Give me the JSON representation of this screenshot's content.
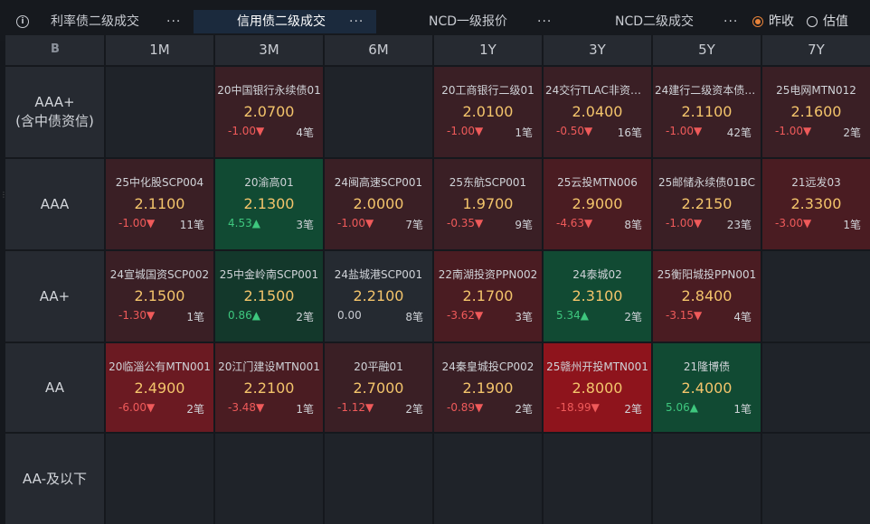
{
  "tabs": [
    {
      "label": "利率债二级成交",
      "more": "···",
      "active": false
    },
    {
      "label": "信用债二级成交",
      "more": "···",
      "active": true
    },
    {
      "label": "NCD一级报价",
      "more": "···",
      "active": false
    },
    {
      "label": "NCD二级成交",
      "more": "···",
      "active": false
    }
  ],
  "info_icon": "i",
  "options": {
    "prev_close": "昨收",
    "valuation": "估值",
    "selected": "prev_close"
  },
  "corner_symbol": "B",
  "columns": [
    "1M",
    "3M",
    "6M",
    "1Y",
    "3Y",
    "5Y",
    "7Y"
  ],
  "rows": [
    {
      "label": [
        "AAA+",
        "(含中债资信)"
      ],
      "cells": [
        null,
        {
          "name": "20中国银行永续债01",
          "price": "2.0700",
          "change": "-1.00▼",
          "count": "4笔",
          "tone": "c-dr",
          "dir": "neg"
        },
        null,
        {
          "name": "20工商银行二级01",
          "price": "2.0100",
          "change": "-1.00▼",
          "count": "1笔",
          "tone": "c-dr",
          "dir": "neg"
        },
        {
          "name": "24交行TLAC非资本...",
          "price": "2.0400",
          "change": "-0.50▼",
          "count": "16笔",
          "tone": "c-dr",
          "dir": "neg"
        },
        {
          "name": "24建行二级资本债0...",
          "price": "2.1100",
          "change": "-1.00▼",
          "count": "42笔",
          "tone": "c-dr",
          "dir": "neg"
        },
        {
          "name": "25电网MTN012",
          "price": "2.1600",
          "change": "-1.00▼",
          "count": "2笔",
          "tone": "c-dr",
          "dir": "neg"
        }
      ]
    },
    {
      "label": [
        "AAA"
      ],
      "cells": [
        {
          "name": "25中化股SCP004",
          "price": "2.1100",
          "change": "-1.00▼",
          "count": "11笔",
          "tone": "c-dr",
          "dir": "neg"
        },
        {
          "name": "20渝高01",
          "price": "2.1300",
          "change": "4.53▲",
          "count": "3笔",
          "tone": "c-g",
          "dir": "pos"
        },
        {
          "name": "24闽高速SCP001",
          "price": "2.0000",
          "change": "-1.00▼",
          "count": "7笔",
          "tone": "c-dr",
          "dir": "neg"
        },
        {
          "name": "25东航SCP001",
          "price": "1.9700",
          "change": "-0.35▼",
          "count": "9笔",
          "tone": "c-dr",
          "dir": "neg"
        },
        {
          "name": "25云投MTN006",
          "price": "2.9000",
          "change": "-4.63▼",
          "count": "8笔",
          "tone": "c-r",
          "dir": "neg"
        },
        {
          "name": "25邮储永续债01BC",
          "price": "2.2150",
          "change": "-1.00▼",
          "count": "23笔",
          "tone": "c-dr",
          "dir": "neg"
        },
        {
          "name": "21远发03",
          "price": "2.3300",
          "change": "-3.00▼",
          "count": "1笔",
          "tone": "c-r",
          "dir": "neg"
        }
      ]
    },
    {
      "label": [
        "AA+"
      ],
      "cells": [
        {
          "name": "24宣城国资SCP002",
          "price": "2.1500",
          "change": "-1.30▼",
          "count": "1笔",
          "tone": "c-dr",
          "dir": "neg"
        },
        {
          "name": "25中金岭南SCP001",
          "price": "2.1500",
          "change": "0.86▲",
          "count": "2笔",
          "tone": "c-dg",
          "dir": "pos"
        },
        {
          "name": "24盐城港SCP001",
          "price": "2.2100",
          "change": "0.00",
          "count": "8笔",
          "tone": "c-n",
          "dir": "flat"
        },
        {
          "name": "22南湖投资PPN002",
          "price": "2.1700",
          "change": "-3.62▼",
          "count": "3笔",
          "tone": "c-r",
          "dir": "neg"
        },
        {
          "name": "24泰城02",
          "price": "2.3100",
          "change": "5.34▲",
          "count": "2笔",
          "tone": "c-g",
          "dir": "pos"
        },
        {
          "name": "25衡阳城投PPN001",
          "price": "2.8400",
          "change": "-3.15▼",
          "count": "4笔",
          "tone": "c-r",
          "dir": "neg"
        },
        null
      ]
    },
    {
      "label": [
        "AA"
      ],
      "cells": [
        {
          "name": "20临淄公有MTN001",
          "price": "2.4900",
          "change": "-6.00▼",
          "count": "2笔",
          "tone": "c-r2",
          "dir": "neg"
        },
        {
          "name": "20江门建设MTN001",
          "price": "2.2100",
          "change": "-3.48▼",
          "count": "1笔",
          "tone": "c-r",
          "dir": "neg"
        },
        {
          "name": "20平融01",
          "price": "2.7000",
          "change": "-1.12▼",
          "count": "2笔",
          "tone": "c-dr",
          "dir": "neg"
        },
        {
          "name": "24秦皇城投CP002",
          "price": "2.1900",
          "change": "-0.89▼",
          "count": "2笔",
          "tone": "c-dr",
          "dir": "neg"
        },
        {
          "name": "25赣州开投MTN001",
          "price": "2.8000",
          "change": "-18.99▼",
          "count": "2笔",
          "tone": "c-r3",
          "dir": "neg"
        },
        {
          "name": "21隆博债",
          "price": "2.4000",
          "change": "5.06▲",
          "count": "1笔",
          "tone": "c-g",
          "dir": "pos"
        },
        null
      ]
    },
    {
      "label": [
        "AA-及以下"
      ],
      "cells": [
        null,
        null,
        null,
        null,
        null,
        null,
        null
      ]
    }
  ]
}
